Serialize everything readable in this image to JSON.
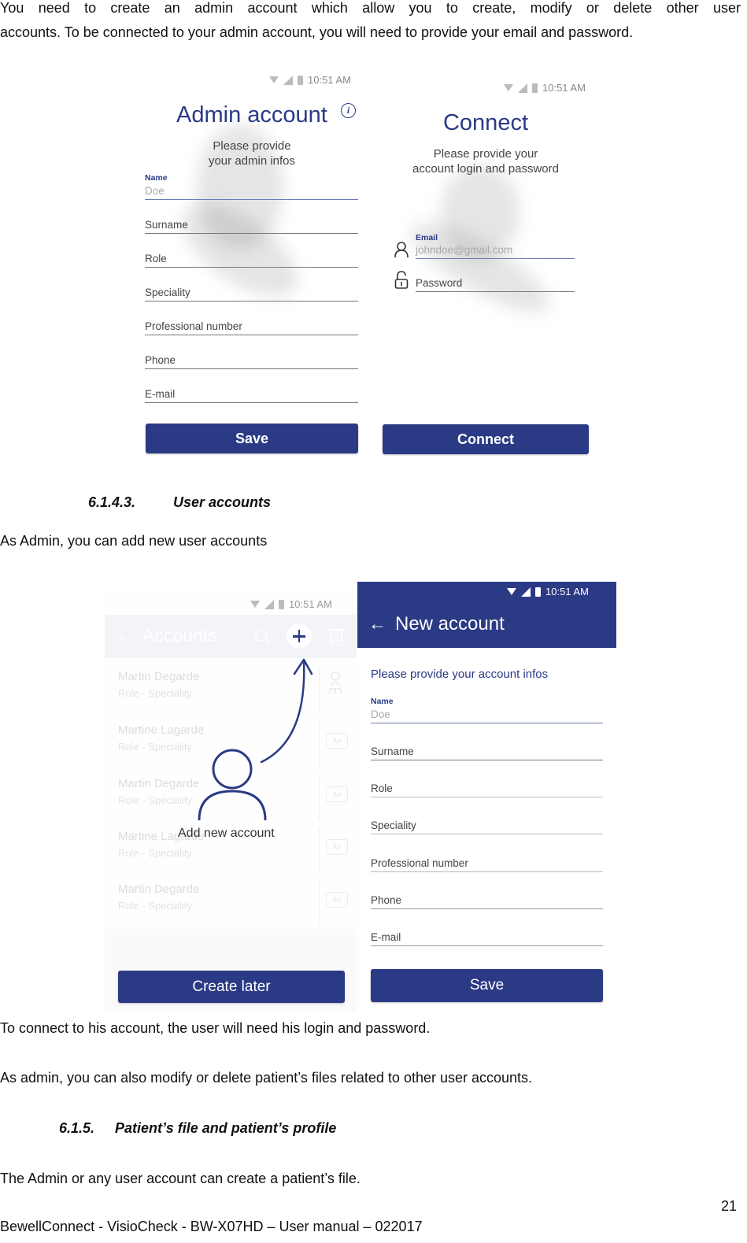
{
  "document": {
    "intro_line1": "You need to create an admin account which allow you to create, modify or delete other user",
    "intro_line2": "accounts. To be connected to your admin account, you will need to provide your email and password.",
    "section_6143_number": "6.1.4.3.",
    "section_6143_title": "User accounts",
    "user_accounts_text": "As Admin, you can add new user accounts",
    "connect_text": "To connect to his account, the user will need his login and password.",
    "admin_modify_text": "As admin, you can also modify or delete patient’s files related to other user accounts.",
    "section_615_number": "6.1.5.",
    "section_615_title": "Patient’s file and patient’s profile",
    "patient_file_text": "The Admin or any user account can create a patient’s file.",
    "page_number": "21",
    "footer": "BewellConnect - VisioCheck - BW-X07HD – User manual – 022017"
  },
  "colors": {
    "brand_blue": "#2b3a85"
  },
  "admin_screen": {
    "time": "10:51 AM",
    "title": "Admin account",
    "info_icon": "info-icon",
    "subtitle_line1": "Please provide",
    "subtitle_line2": "your admin infos",
    "name_label": "Name",
    "name_value": "Doe",
    "fields": [
      "Surname",
      "Role",
      "Speciality",
      "Professional number",
      "Phone",
      "E-mail"
    ],
    "save_label": "Save"
  },
  "connect_screen": {
    "time": "10:51 AM",
    "title": "Connect",
    "subtitle_line1": "Please provide your",
    "subtitle_line2": "account login and password",
    "email_label": "Email",
    "email_value": "johndoe@gmail.com",
    "password_placeholder": "Password",
    "connect_label": "Connect"
  },
  "accounts_screen": {
    "time": "10:51 AM",
    "title": "Accounts",
    "accounts": [
      {
        "name": "Martin Degarde",
        "role": "Role - Speciality",
        "icon": "admin-icon"
      },
      {
        "name": "Martine Lagarde",
        "role": "Role - Speciality",
        "icon": "id-card-icon"
      },
      {
        "name": "Martin Degarde",
        "role": "Role - Speciality",
        "icon": "id-card-icon"
      },
      {
        "name": "Martine Lagarde",
        "role": "Role - Speciality",
        "icon": "id-card-icon"
      },
      {
        "name": "Martin Degarde",
        "role": "Role - Speciality",
        "icon": "id-card-icon"
      }
    ],
    "add_new_account_label": "Add new account",
    "create_later_label": "Create later"
  },
  "new_account_screen": {
    "time": "10:51 AM",
    "title": "New account",
    "subtitle": "Please provide your account infos",
    "name_label": "Name",
    "name_value": "Doe",
    "fields": [
      "Surname",
      "Role",
      "Speciality",
      "Professional number",
      "Phone",
      "E-mail"
    ],
    "save_label": "Save"
  }
}
